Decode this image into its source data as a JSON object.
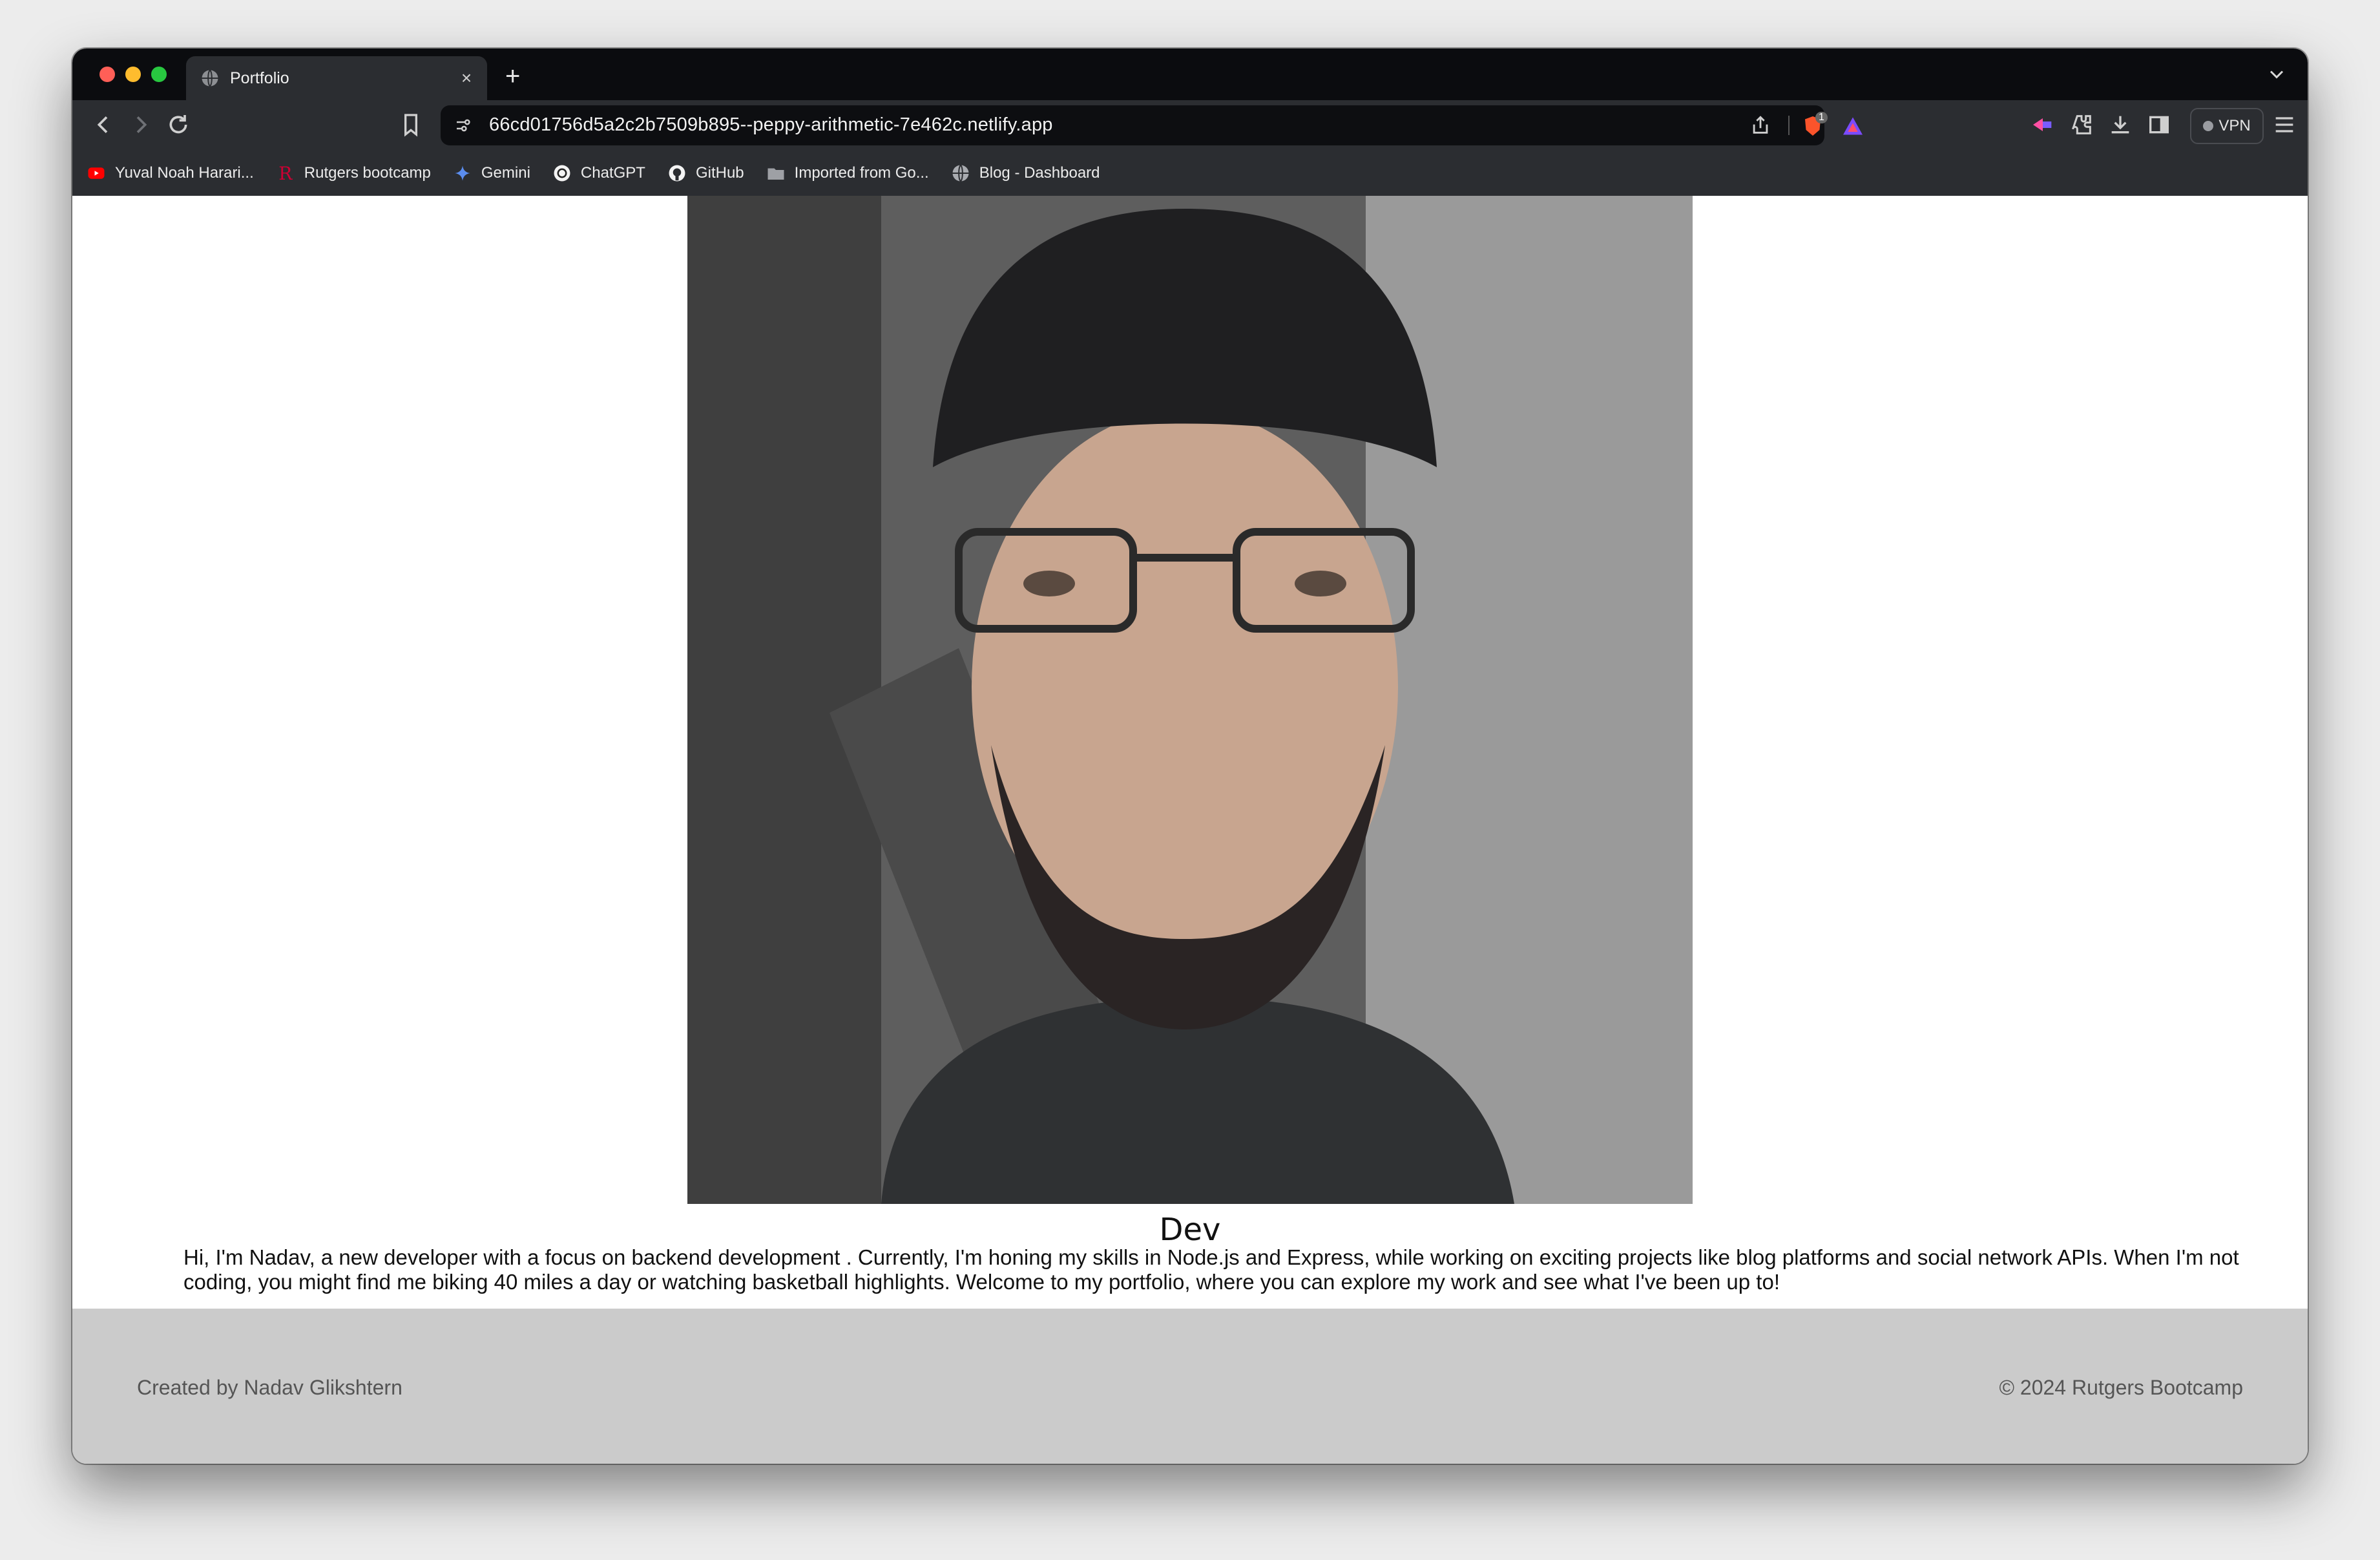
{
  "browser": {
    "tab_title": "Portfolio",
    "new_tab_label": "+",
    "close_tab_label": "×",
    "url": "66cd01756d5a2c2b7509b895--peppy-arithmetic-7e462c.netlify.app",
    "shields_count": "1",
    "vpn_label": "VPN",
    "traffic_light_colors": [
      "#ff5f57",
      "#febc2e",
      "#28c840"
    ]
  },
  "bookmarks": [
    {
      "label": "Yuval Noah Harari...",
      "icon": "youtube-icon"
    },
    {
      "label": "Rutgers bootcamp",
      "icon": "rutgers-r-icon"
    },
    {
      "label": "Gemini",
      "icon": "sparkle-icon"
    },
    {
      "label": "ChatGPT",
      "icon": "chatgpt-icon"
    },
    {
      "label": "GitHub",
      "icon": "github-icon"
    },
    {
      "label": "Imported from Go...",
      "icon": "folder-icon"
    },
    {
      "label": "Blog - Dashboard",
      "icon": "globe-icon"
    }
  ],
  "page": {
    "name": "Dev",
    "bio": "Hi, I'm Nadav, a new developer with a focus on backend development . Currently, I'm honing my skills in Node.js and Express, while working on exciting projects like blog platforms and social network APIs. When I'm not coding, you might find me biking 40 miles a day or watching basketball highlights. Welcome to my portfolio, where you can explore my work and see what I've been up to!",
    "profile_photo": "profile-photo"
  },
  "footer": {
    "left": "Created by Nadav Glikshtern",
    "right": "© 2024 Rutgers Bootcamp"
  }
}
